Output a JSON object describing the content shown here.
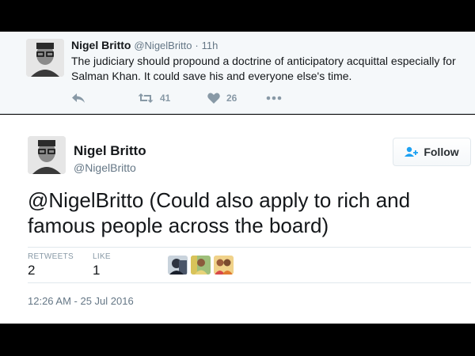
{
  "parent_tweet": {
    "name": "Nigel Britto",
    "handle": "@NigelBritto",
    "dot": "·",
    "time": "11h",
    "text": "The judiciary should propound a doctrine of anticipatory acquittal especially for Salman Khan. It could save his and everyone else's time.",
    "retweet_count": "41",
    "like_count": "26"
  },
  "main_tweet": {
    "name": "Nigel Britto",
    "handle": "@NigelBritto",
    "follow_label": "Follow",
    "mention": "@NigelBritto",
    "text": " (Could also apply to rich and famous people across the board)",
    "retweets_label": "RETWEETS",
    "retweets_value": "2",
    "likes_label": "LIKE",
    "likes_value": "1",
    "timestamp": "12:26 AM - 25 Jul 2016"
  },
  "colors": {
    "icon_gray": "#8899a6",
    "parent_bg": "#f5f8fa",
    "border": "#e1e8ed",
    "follow_icon": "#1da1f2"
  }
}
